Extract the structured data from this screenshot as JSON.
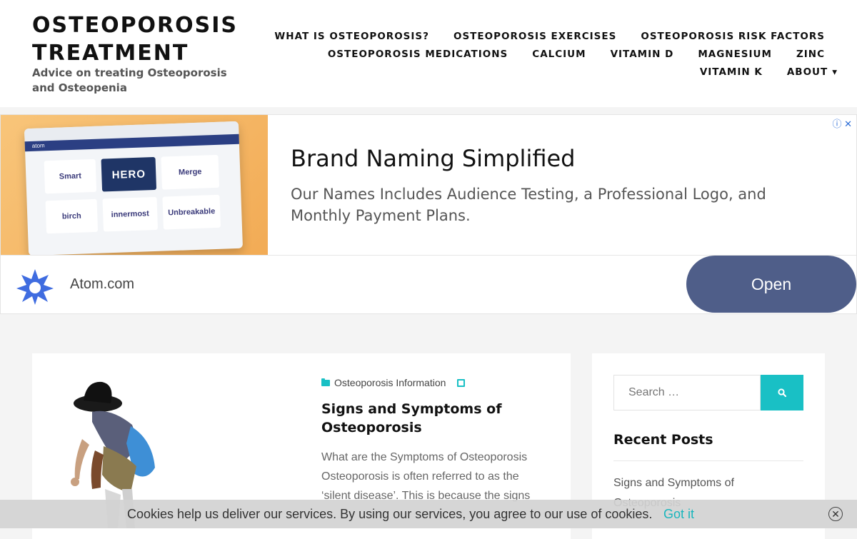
{
  "header": {
    "site_title": "OSTEOPOROSIS TREATMENT",
    "site_description": "Advice on treating Osteoporosis and Osteopenia",
    "nav_row1": [
      "WHAT IS OSTEOPOROSIS?",
      "OSTEOPOROSIS EXERCISES",
      "OSTEOPOROSIS RISK FACTORS"
    ],
    "nav_row2": [
      "OSTEOPOROSIS MEDICATIONS",
      "CALCIUM",
      "VITAMIN D",
      "MAGNESIUM",
      "ZINC"
    ],
    "nav_row3": [
      "VITAMIN K",
      "ABOUT"
    ]
  },
  "ad": {
    "title": "Brand Naming Simplified",
    "body": "Our Names Includes Audience Testing, a Professional Logo, and Monthly Payment Plans.",
    "domain": "Atom.com",
    "cta": "Open",
    "image_brand": "atom",
    "tiles": [
      "Smart",
      "HERO",
      "Merge",
      "birch",
      "innermost",
      "Unbreakable"
    ],
    "adchoice_icon": "ⓘ ✕"
  },
  "article": {
    "category": "Osteoporosis Information",
    "title": "Signs and Symptoms of Osteoporosis",
    "excerpt": "What are the Symptoms of Osteoporosis Osteoporosis is often referred to as the ‘silent disease’. This is because the signs"
  },
  "sidebar": {
    "search_placeholder": "Search …",
    "recent_title": "Recent Posts",
    "recent_items": [
      "Signs and Symptoms of Osteoporosis"
    ]
  },
  "cookie": {
    "text": "Cookies help us deliver our services. By using our services, you agree to our use of cookies.",
    "accept": "Got it",
    "close_glyph": "✕"
  },
  "colors": {
    "accent": "#19c0c5",
    "ad_button": "#4f5e89"
  }
}
